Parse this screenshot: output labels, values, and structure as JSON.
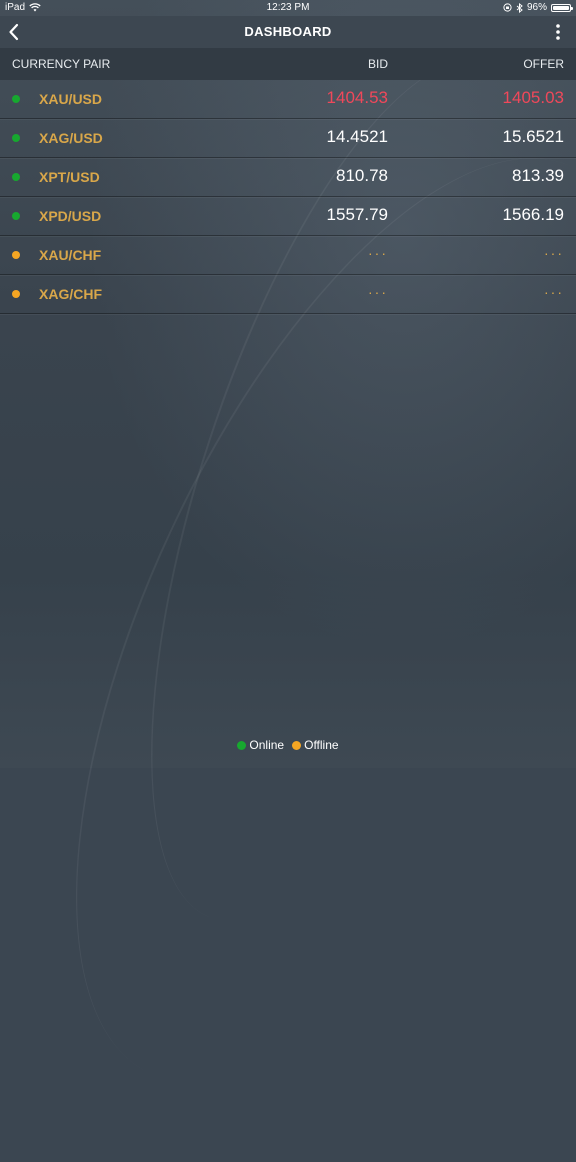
{
  "status_bar": {
    "device": "iPad",
    "time": "12:23 PM",
    "battery": "96%"
  },
  "nav": {
    "title": "DASHBOARD",
    "back_icon": "chevron-left-icon",
    "more_icon": "more-vertical-icon"
  },
  "table": {
    "headers": {
      "pair": "CURRENCY PAIR",
      "bid": "BID",
      "offer": "OFFER"
    },
    "rows": [
      {
        "pair": "XAU/USD",
        "status": "online",
        "bid": "1404.53",
        "offer": "1405.03",
        "trend": "neg"
      },
      {
        "pair": "XAG/USD",
        "status": "online",
        "bid": "14.4521",
        "offer": "15.6521",
        "trend": "pos"
      },
      {
        "pair": "XPT/USD",
        "status": "online",
        "bid": "810.78",
        "offer": "813.39",
        "trend": "pos"
      },
      {
        "pair": "XPD/USD",
        "status": "online",
        "bid": "1557.79",
        "offer": "1566.19",
        "trend": "pos"
      },
      {
        "pair": "XAU/CHF",
        "status": "offline",
        "bid": "···",
        "offer": "···",
        "trend": "none"
      },
      {
        "pair": "XAG/CHF",
        "status": "offline",
        "bid": "···",
        "offer": "···",
        "trend": "none"
      }
    ]
  },
  "legend": {
    "online": "Online",
    "offline": "Offline"
  },
  "colors": {
    "online": "#17a82f",
    "offline": "#f5a623",
    "pair_text": "#d9a74a",
    "negative": "#f0485a"
  }
}
